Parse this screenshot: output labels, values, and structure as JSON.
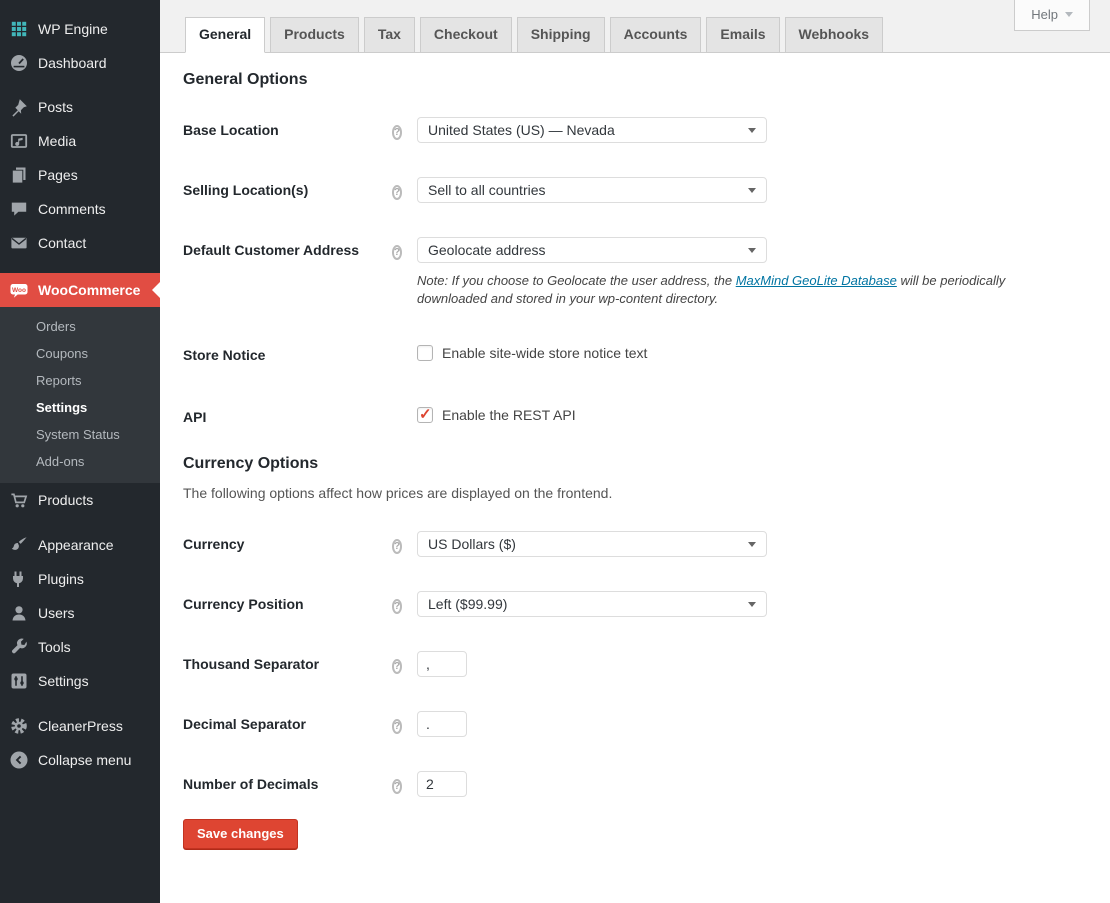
{
  "app": {
    "help_label": "Help"
  },
  "accent_colors": {
    "menu_highlight": "#e14d43",
    "sidebar_bg": "#23282d",
    "submenu_bg": "#32373c",
    "wp_engine_icon_teal": "#41b7ba",
    "link_blue": "#0074a2",
    "save_button_red": "#de4532",
    "checkmark_red": "#dd4632"
  },
  "sidebar": {
    "wp_engine": "WP Engine",
    "dashboard": "Dashboard",
    "posts": "Posts",
    "media": "Media",
    "pages": "Pages",
    "comments": "Comments",
    "contact": "Contact",
    "woocommerce": "WooCommerce",
    "submenu": {
      "orders": "Orders",
      "coupons": "Coupons",
      "reports": "Reports",
      "settings": "Settings",
      "system_status": "System Status",
      "addons": "Add-ons"
    },
    "products": "Products",
    "appearance": "Appearance",
    "plugins": "Plugins",
    "users": "Users",
    "tools": "Tools",
    "settings": "Settings",
    "cleanerpress": "CleanerPress",
    "collapse": "Collapse menu"
  },
  "tabs": {
    "general": "General",
    "products": "Products",
    "tax": "Tax",
    "checkout": "Checkout",
    "shipping": "Shipping",
    "accounts": "Accounts",
    "emails": "Emails",
    "webhooks": "Webhooks",
    "active_tab": "General"
  },
  "general": {
    "title": "General Options",
    "base_location": {
      "label": "Base Location",
      "value": "United States (US) — Nevada"
    },
    "selling_location": {
      "label": "Selling Location(s)",
      "value": "Sell to all countries"
    },
    "default_customer_address": {
      "label": "Default Customer Address",
      "value": "Geolocate address",
      "note_prefix": "Note: If you choose to Geolocate the user address, the ",
      "note_link": "MaxMind GeoLite Database",
      "note_suffix": " will be periodically downloaded and stored in your wp-content directory."
    },
    "store_notice": {
      "label": "Store Notice",
      "checkbox_label": "Enable site-wide store notice text",
      "checked": false
    },
    "api": {
      "label": "API",
      "checkbox_label": "Enable the REST API",
      "checked": true
    }
  },
  "currency_options": {
    "title": "Currency Options",
    "description": "The following options affect how prices are displayed on the frontend.",
    "currency": {
      "label": "Currency",
      "value": "US Dollars ($)"
    },
    "currency_position": {
      "label": "Currency Position",
      "value": "Left ($99.99)"
    },
    "thousand_separator": {
      "label": "Thousand Separator",
      "value": ","
    },
    "decimal_separator": {
      "label": "Decimal Separator",
      "value": "."
    },
    "num_decimals": {
      "label": "Number of Decimals",
      "value": "2"
    }
  },
  "save_button_label": "Save changes"
}
